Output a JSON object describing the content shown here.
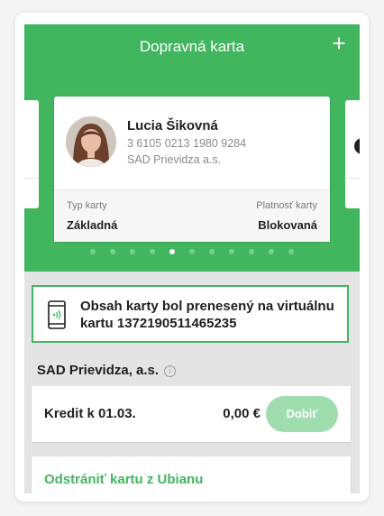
{
  "header": {
    "title": "Dopravná karta",
    "add_label": "+"
  },
  "card": {
    "holder_name": "Lucia Šikovná",
    "card_number": "3 6105 0213 1980 9284",
    "operator": "SAD Prievidza a.s.",
    "type_label": "Typ karty",
    "type_value": "Základná",
    "validity_label": "Platnosť karty",
    "validity_value": "Blokovaná"
  },
  "pagination": {
    "total": 11,
    "active_index": 4
  },
  "notice": {
    "text": "Obsah karty bol prenesený na virtuálnu kartu 1372190511465235",
    "icon": "phone-nfc-icon"
  },
  "operator_section": {
    "label": "SAD Prievidza, a.s.",
    "info_icon": "i"
  },
  "credit": {
    "label": "Kredit k 01.03.",
    "value": "0,00 €",
    "topup_label": "Dobiť"
  },
  "remove": {
    "label": "Odstrániť kartu z Ubianu"
  },
  "colors": {
    "brand_green": "#42b55f",
    "disabled_green": "#9fdcae"
  }
}
